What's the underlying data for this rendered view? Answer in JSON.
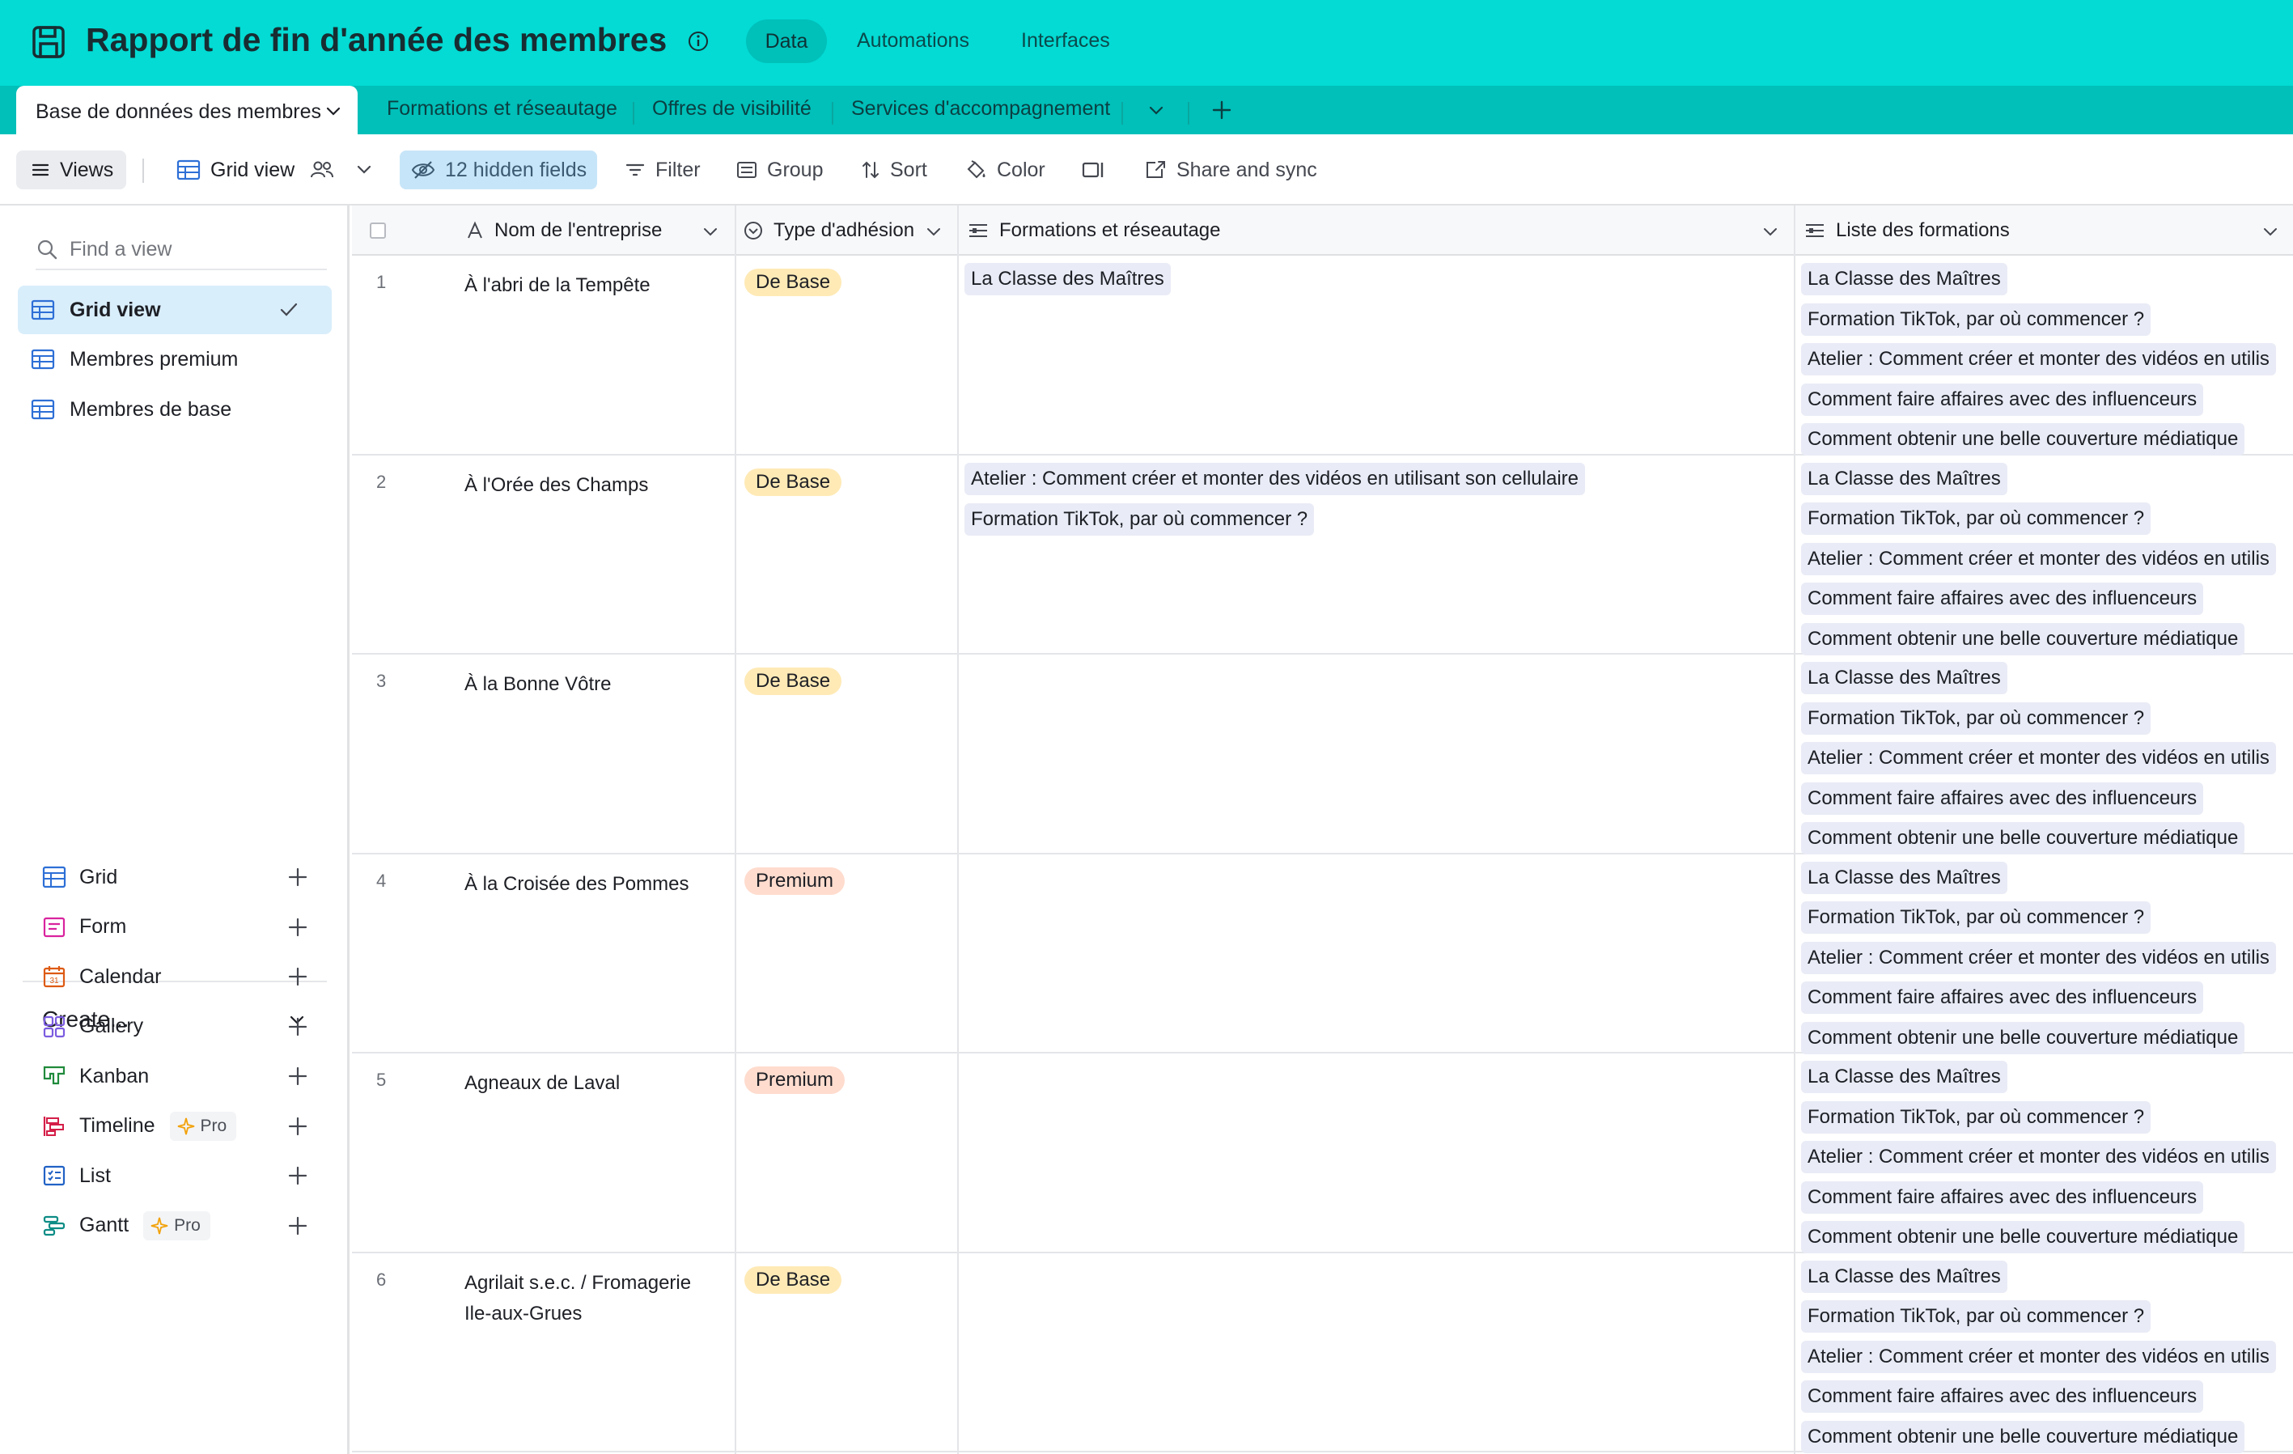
{
  "header": {
    "title": "Rapport de fin d'année des membres",
    "tabs": [
      {
        "label": "Data",
        "active": true
      },
      {
        "label": "Automations",
        "active": false
      },
      {
        "label": "Interfaces",
        "active": false
      }
    ]
  },
  "table_tabs": {
    "active": "Base de données des membres",
    "others": [
      "Formations et réseautage",
      "Offres de visibilité",
      "Services d'accompagnement"
    ]
  },
  "toolbar": {
    "views_label": "Views",
    "view_name": "Grid view",
    "hidden_fields": "12 hidden fields",
    "filter": "Filter",
    "group": "Group",
    "sort": "Sort",
    "color": "Color",
    "share": "Share and sync"
  },
  "sidebar": {
    "find_placeholder": "Find a view",
    "views": [
      {
        "label": "Grid view",
        "active": true
      },
      {
        "label": "Membres premium",
        "active": false
      },
      {
        "label": "Membres de base",
        "active": false
      }
    ],
    "create_label": "Create...",
    "create_items": [
      {
        "label": "Grid"
      },
      {
        "label": "Form"
      },
      {
        "label": "Calendar"
      },
      {
        "label": "Gallery"
      },
      {
        "label": "Kanban"
      },
      {
        "label": "Timeline",
        "badge": "Pro"
      },
      {
        "label": "List"
      },
      {
        "label": "Gantt",
        "badge": "Pro"
      }
    ],
    "colors": {
      "grid": "#2d6fd6",
      "form": "#d9239e",
      "calendar": "#dd5a13",
      "gallery": "#7b5ce0",
      "kanban": "#1f8a3b",
      "timeline": "#d41e48",
      "list": "#2162c5",
      "gantt": "#0c8c85"
    }
  },
  "grid": {
    "columns": [
      {
        "label": "Nom de l'entreprise",
        "icon": "text-icon"
      },
      {
        "label": "Type d'adhésion",
        "icon": "single-select-icon"
      },
      {
        "label": "Formations et réseautage",
        "icon": "linked-record-icon"
      },
      {
        "label": "Liste des formations",
        "icon": "linked-record-icon"
      }
    ],
    "rows": [
      {
        "num": "1",
        "company": "À l'abri de la Tempête",
        "type": "De Base",
        "formations": [
          "La Classe des Maîtres"
        ],
        "liste": [
          "La Classe des Maîtres",
          "Formation TikTok, par où commencer ?",
          "Atelier : Comment créer et monter des vidéos en utilis",
          "Comment faire affaires avec des influenceurs",
          "Comment obtenir une belle couverture médiatique"
        ]
      },
      {
        "num": "2",
        "company": "À l'Orée des Champs",
        "type": "De Base",
        "formations": [
          "Atelier : Comment créer et monter des vidéos en utilisant son cellulaire",
          "Formation TikTok, par où commencer ?"
        ],
        "liste": [
          "La Classe des Maîtres",
          "Formation TikTok, par où commencer ?",
          "Atelier : Comment créer et monter des vidéos en utilis",
          "Comment faire affaires avec des influenceurs",
          "Comment obtenir une belle couverture médiatique"
        ]
      },
      {
        "num": "3",
        "company": "À la Bonne Vôtre",
        "type": "De Base",
        "formations": [],
        "liste": [
          "La Classe des Maîtres",
          "Formation TikTok, par où commencer ?",
          "Atelier : Comment créer et monter des vidéos en utilis",
          "Comment faire affaires avec des influenceurs",
          "Comment obtenir une belle couverture médiatique"
        ]
      },
      {
        "num": "4",
        "company": "À la Croisée des Pommes",
        "type": "Premium",
        "formations": [],
        "liste": [
          "La Classe des Maîtres",
          "Formation TikTok, par où commencer ?",
          "Atelier : Comment créer et monter des vidéos en utilis",
          "Comment faire affaires avec des influenceurs",
          "Comment obtenir une belle couverture médiatique"
        ]
      },
      {
        "num": "5",
        "company": "Agneaux de Laval",
        "type": "Premium",
        "formations": [],
        "liste": [
          "La Classe des Maîtres",
          "Formation TikTok, par où commencer ?",
          "Atelier : Comment créer et monter des vidéos en utilis",
          "Comment faire affaires avec des influenceurs",
          "Comment obtenir une belle couverture médiatique"
        ]
      },
      {
        "num": "6",
        "company": "Agrilait s.e.c. / Fromagerie Ile-aux-Grues",
        "type": "De Base",
        "formations": [],
        "liste": [
          "La Classe des Maîtres",
          "Formation TikTok, par où commencer ?",
          "Atelier : Comment créer et monter des vidéos en utilis",
          "Comment faire affaires avec des influenceurs",
          "Comment obtenir une belle couverture médiatique"
        ]
      }
    ]
  }
}
